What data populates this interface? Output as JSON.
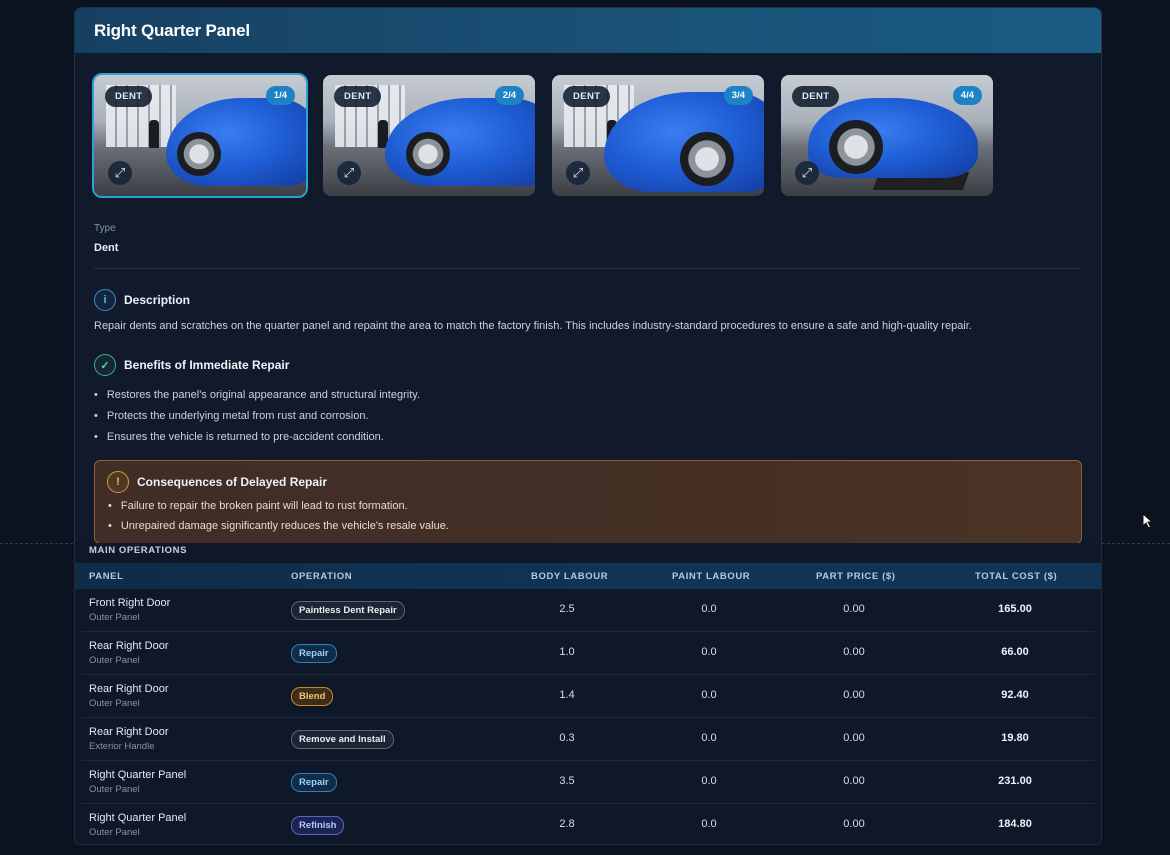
{
  "panel": {
    "title": "Right Quarter Panel",
    "images": [
      {
        "tag": "DENT",
        "count": "1/4",
        "active": true
      },
      {
        "tag": "DENT",
        "count": "2/4",
        "active": false
      },
      {
        "tag": "DENT",
        "count": "3/4",
        "active": false
      },
      {
        "tag": "DENT",
        "count": "4/4",
        "active": false
      }
    ],
    "type_label": "Type",
    "type_value": "Dent",
    "description": {
      "title": "Description",
      "text": "Repair dents and scratches on the quarter panel and repaint the area to match the factory finish. This includes industry-standard procedures to ensure a safe and high-quality repair."
    },
    "benefits": {
      "title": "Benefits of Immediate Repair",
      "items": [
        "Restores the panel's original appearance and structural integrity.",
        "Protects the underlying metal from rust and corrosion.",
        "Ensures the vehicle is returned to pre-accident condition."
      ]
    },
    "consequences": {
      "title": "Consequences of Delayed Repair",
      "items": [
        "Failure to repair the broken paint will lead to rust formation.",
        "Unrepaired damage significantly reduces the vehicle's resale value."
      ]
    }
  },
  "operations": {
    "title": "MAIN OPERATIONS",
    "headers": {
      "panel": "PANEL",
      "operation": "OPERATION",
      "body_labour": "BODY LABOUR",
      "paint_labour": "PAINT LABOUR",
      "part_price": "PART PRICE ($)",
      "total_cost": "TOTAL COST ($)"
    },
    "rows": [
      {
        "panel": "Front Right Door",
        "sub": "Outer Panel",
        "operation": "Paintless Dent Repair",
        "style": "neutral",
        "body": "2.5",
        "paint": "0.0",
        "part": "0.00",
        "total": "165.00"
      },
      {
        "panel": "Rear Right Door",
        "sub": "Outer Panel",
        "operation": "Repair",
        "style": "blue",
        "body": "1.0",
        "paint": "0.0",
        "part": "0.00",
        "total": "66.00"
      },
      {
        "panel": "Rear Right Door",
        "sub": "Outer Panel",
        "operation": "Blend",
        "style": "amber",
        "body": "1.4",
        "paint": "0.0",
        "part": "0.00",
        "total": "92.40"
      },
      {
        "panel": "Rear Right Door",
        "sub": "Exterior Handle",
        "operation": "Remove and Install",
        "style": "neutral",
        "body": "0.3",
        "paint": "0.0",
        "part": "0.00",
        "total": "19.80"
      },
      {
        "panel": "Right Quarter Panel",
        "sub": "Outer Panel",
        "operation": "Repair",
        "style": "blue",
        "body": "3.5",
        "paint": "0.0",
        "part": "0.00",
        "total": "231.00"
      },
      {
        "panel": "Right Quarter Panel",
        "sub": "Outer Panel",
        "operation": "Refinish",
        "style": "indigo",
        "body": "2.8",
        "paint": "0.0",
        "part": "0.00",
        "total": "184.80"
      }
    ]
  },
  "icons": {
    "description": "info-icon",
    "benefits": "check-circle-icon",
    "consequences": "alert-circle-icon",
    "expand": "expand-icon",
    "cursor": "mouse-pointer-icon"
  },
  "colors": {
    "accent": "#1d83c6",
    "header": "#164062",
    "warning_border": "#8d5f34"
  }
}
